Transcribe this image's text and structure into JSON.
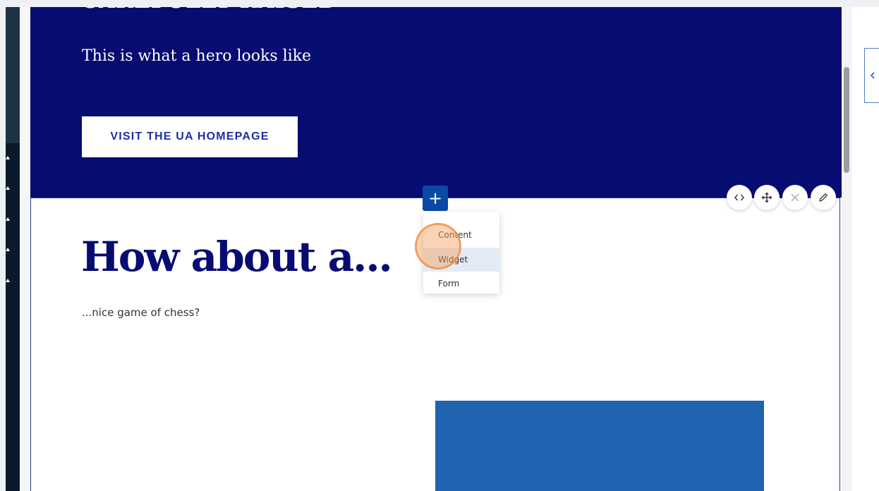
{
  "hero": {
    "eyebrow": "CAREFULLY RAISED",
    "subtitle": "This is what a hero looks like",
    "cta_label": "VISIT THE UA HOMEPAGE"
  },
  "section": {
    "title": "How about a...",
    "body": "...nice game of chess?"
  },
  "add_menu": {
    "button_label": "+",
    "items": [
      {
        "label": "Content"
      },
      {
        "label": "Widget"
      },
      {
        "label": "Form"
      }
    ],
    "hovered": "Widget"
  },
  "toolbar": {
    "buttons": [
      {
        "icon": "code-icon"
      },
      {
        "icon": "move-icon"
      },
      {
        "icon": "close-icon"
      },
      {
        "icon": "pencil-icon"
      }
    ]
  },
  "colors": {
    "hero_bg": "#070c71",
    "cta_text": "#1e2fa4",
    "accent_button": "#0a4aa6",
    "blue_block": "#2063b0"
  }
}
